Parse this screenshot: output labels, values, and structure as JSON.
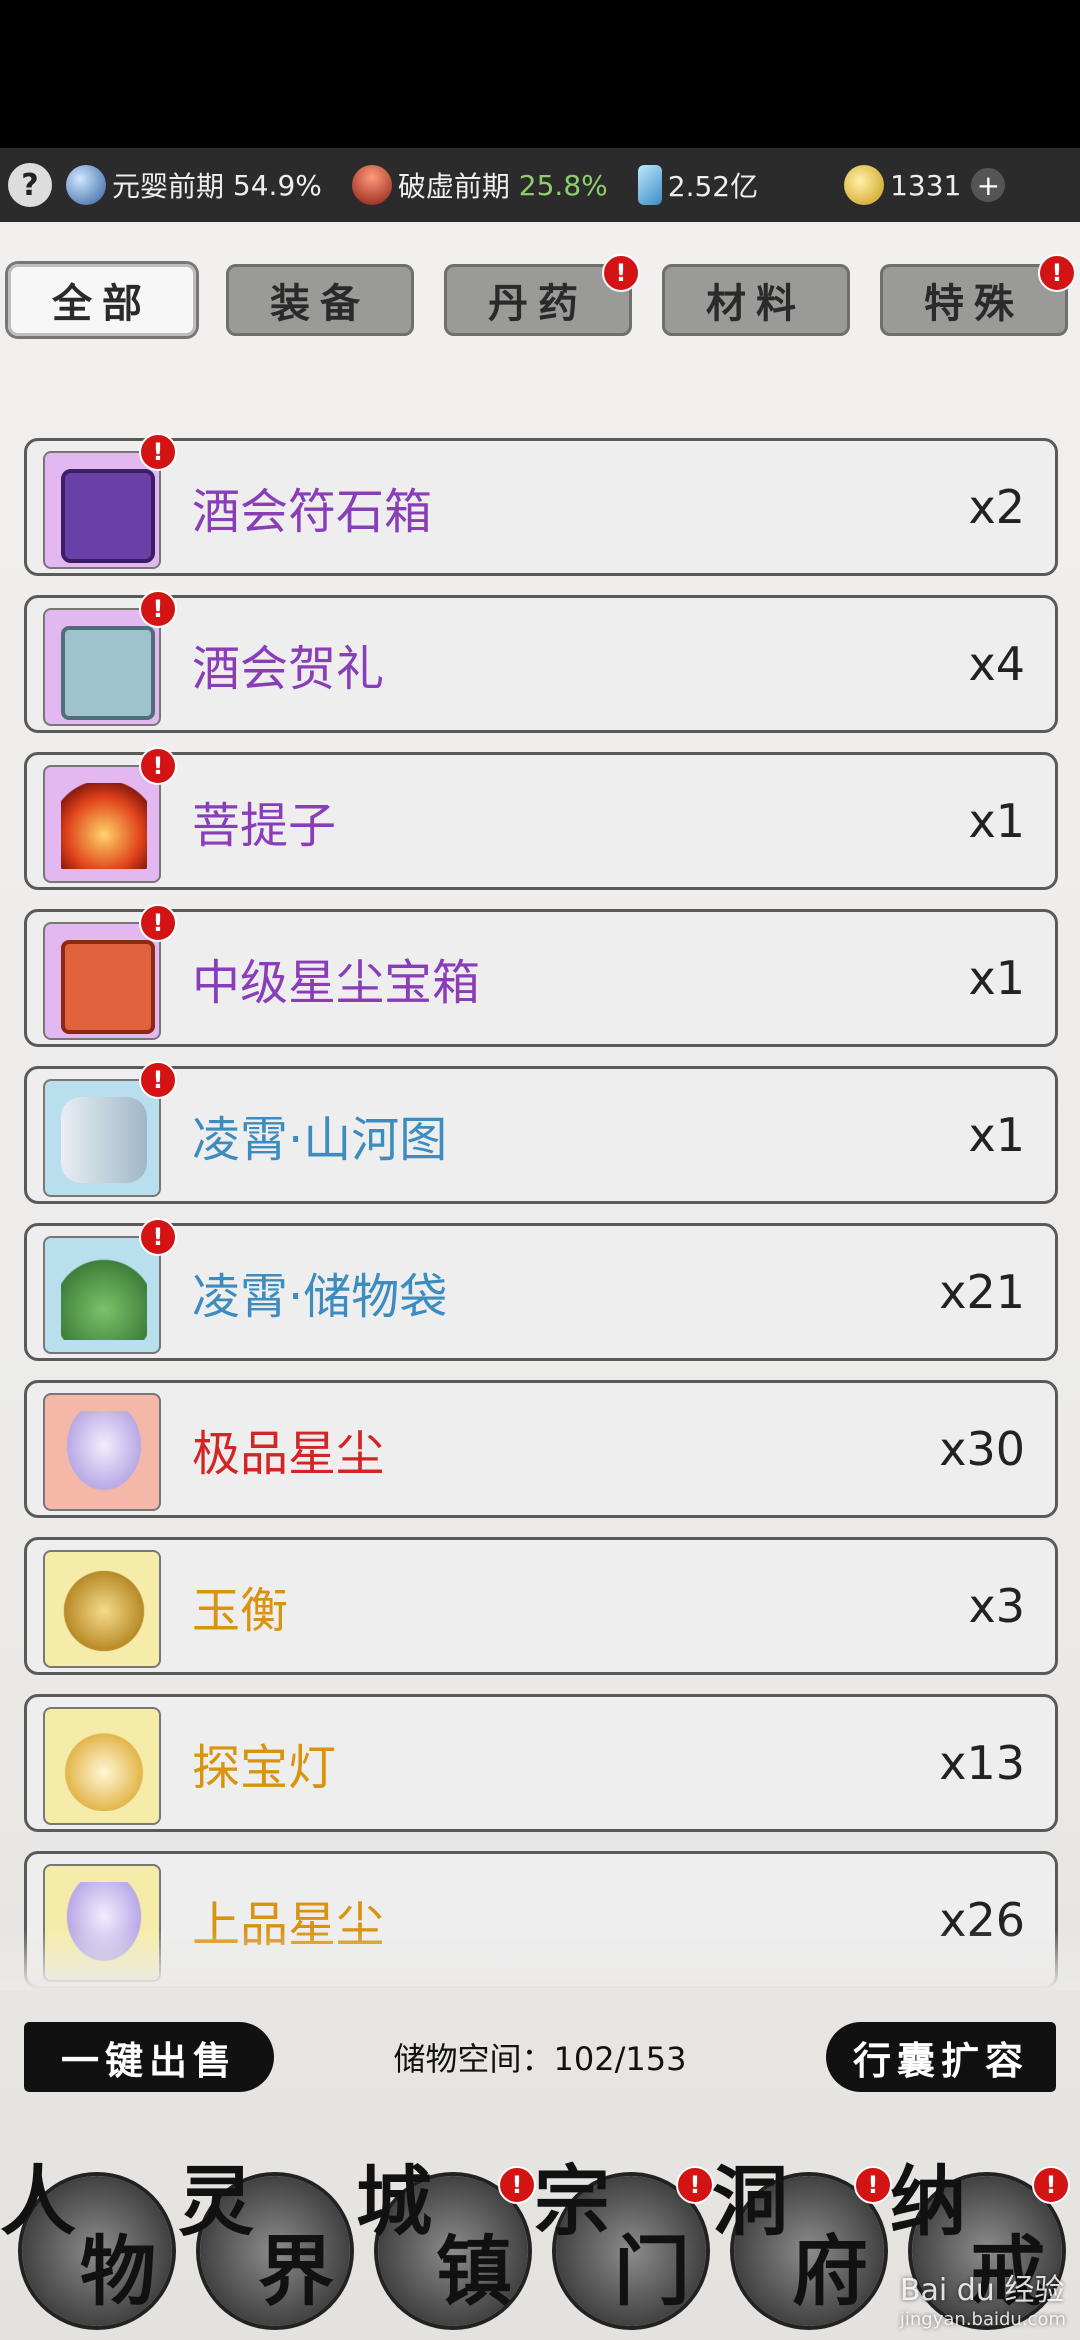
{
  "topbar": {
    "help": "?",
    "realm1_label": "元婴前期",
    "realm1_pct": "54.9%",
    "realm2_label": "破虚前期",
    "realm2_pct": "25.8%",
    "crystals": "2.52亿",
    "gold": "1331",
    "plus": "+"
  },
  "tabs": [
    {
      "label": "全部",
      "active": true,
      "badge": false
    },
    {
      "label": "装备",
      "active": false,
      "badge": false
    },
    {
      "label": "丹药",
      "active": false,
      "badge": true
    },
    {
      "label": "材料",
      "active": false,
      "badge": false
    },
    {
      "label": "特殊",
      "active": false,
      "badge": true
    }
  ],
  "badge_mark": "!",
  "items": [
    {
      "name": "酒会符石箱",
      "qty": "x2",
      "rarity": "purple",
      "icon": "chest-icon",
      "badge": true
    },
    {
      "name": "酒会贺礼",
      "qty": "x4",
      "rarity": "purple",
      "icon": "gift-box-icon",
      "badge": true
    },
    {
      "name": "菩提子",
      "qty": "x1",
      "rarity": "purple",
      "icon": "flame-seed-icon",
      "badge": true
    },
    {
      "name": "中级星尘宝箱",
      "qty": "x1",
      "rarity": "purple",
      "icon": "red-chest-icon",
      "badge": true
    },
    {
      "name": "凌霄·山河图",
      "qty": "x1",
      "rarity": "blue",
      "icon": "scroll-icon",
      "badge": true
    },
    {
      "name": "凌霄·储物袋",
      "qty": "x21",
      "rarity": "blue",
      "icon": "pouch-icon",
      "badge": true
    },
    {
      "name": "极品星尘",
      "qty": "x30",
      "rarity": "red",
      "icon": "stardust-icon",
      "badge": false
    },
    {
      "name": "玉衡",
      "qty": "x3",
      "rarity": "gold",
      "icon": "jade-disc-icon",
      "badge": false
    },
    {
      "name": "探宝灯",
      "qty": "x13",
      "rarity": "gold",
      "icon": "lantern-icon",
      "badge": false
    },
    {
      "name": "上品星尘",
      "qty": "x26",
      "rarity": "gold",
      "icon": "stardust-icon",
      "badge": false
    }
  ],
  "bottom": {
    "sell_all": "一键出售",
    "storage": "储物空间：102/153",
    "expand": "行囊扩容"
  },
  "nav": [
    {
      "c1": "人",
      "c2": "物",
      "badge": false
    },
    {
      "c1": "灵",
      "c2": "界",
      "badge": false
    },
    {
      "c1": "城",
      "c2": "镇",
      "badge": true
    },
    {
      "c1": "宗",
      "c2": "门",
      "badge": true
    },
    {
      "c1": "洞",
      "c2": "府",
      "badge": true
    },
    {
      "c1": "纳",
      "c2": "戒",
      "badge": true
    }
  ],
  "watermark": {
    "main": "Bai du 经验",
    "sub": "jingyan.baidu.com"
  },
  "colors": {
    "purple": "#8a3db8",
    "blue": "#3d8cbf",
    "red": "#d42525",
    "gold": "#d8930f",
    "badge": "#d41414"
  }
}
